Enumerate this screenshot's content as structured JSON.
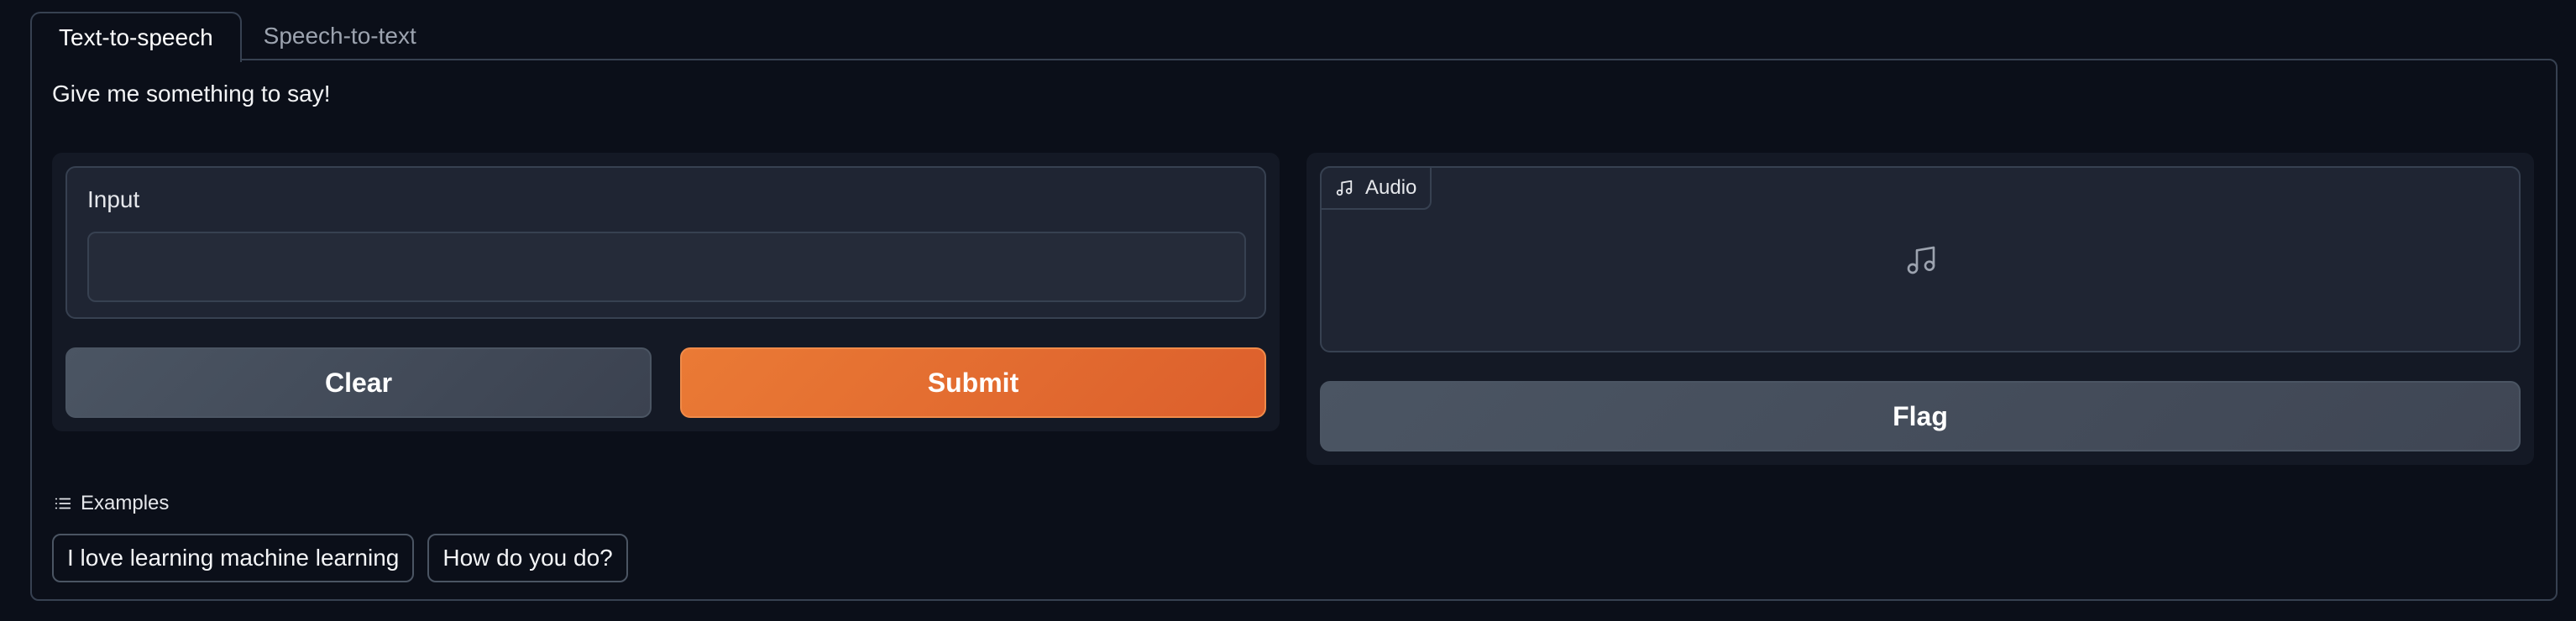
{
  "tabs": [
    {
      "label": "Text-to-speech",
      "active": true
    },
    {
      "label": "Speech-to-text",
      "active": false
    }
  ],
  "description": "Give me something to say!",
  "input": {
    "label": "Input",
    "value": "",
    "placeholder": ""
  },
  "buttons": {
    "clear": "Clear",
    "submit": "Submit",
    "flag": "Flag"
  },
  "audio": {
    "label": "Audio",
    "icon": "music-note-icon"
  },
  "examples": {
    "header": "Examples",
    "icon": "list-icon",
    "items": [
      "I love learning machine learning",
      "How do you do?"
    ]
  },
  "colors": {
    "background": "#0b0f19",
    "submit_accent": "#ea7a35",
    "border": "#374151"
  }
}
